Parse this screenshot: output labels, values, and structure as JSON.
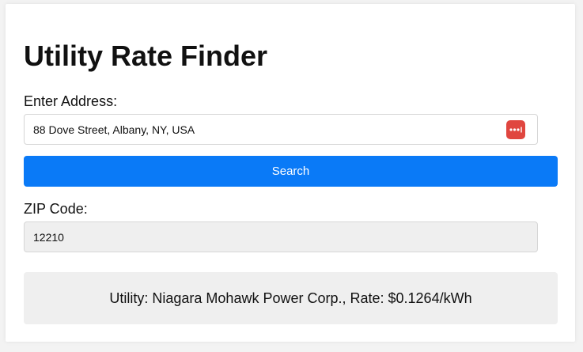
{
  "page": {
    "title": "Utility Rate Finder"
  },
  "address": {
    "label": "Enter Address:",
    "value": "88 Dove Street, Albany, NY, USA",
    "autofill_icon": "password-manager-icon"
  },
  "search": {
    "button_label": "Search"
  },
  "zip": {
    "label": "ZIP Code:",
    "value": "12210"
  },
  "result": {
    "text": "Utility: Niagara Mohawk Power Corp., Rate: $0.1264/kWh"
  },
  "colors": {
    "accent": "#0a7af7",
    "autofill_icon_bg": "#e0463f",
    "readonly_bg": "#efefef"
  }
}
